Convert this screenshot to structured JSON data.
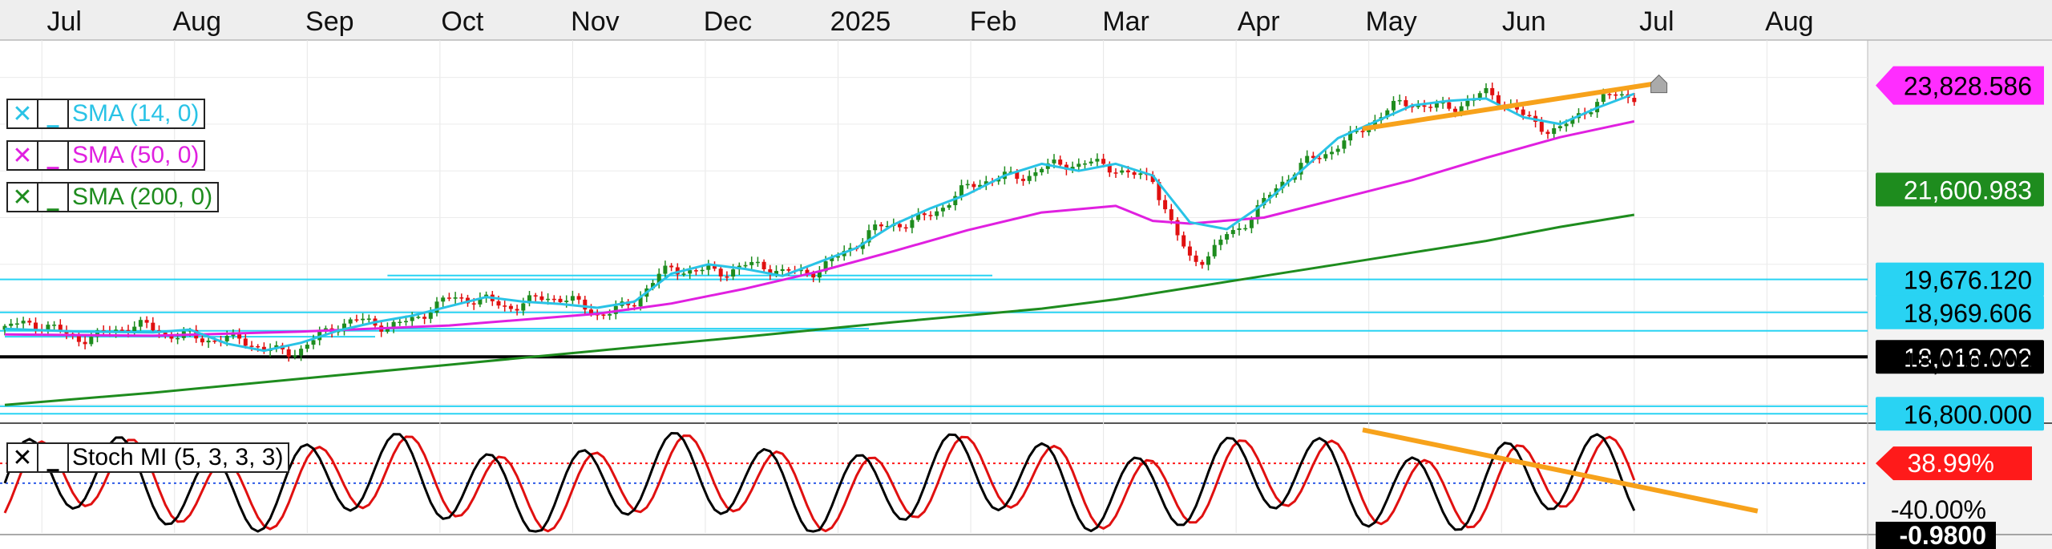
{
  "chart_data": [
    {
      "type": "candlestick",
      "months": [
        "Jul",
        "Aug",
        "Sep",
        "Oct",
        "Nov",
        "Dec",
        "2025",
        "Feb",
        "Mar",
        "Apr",
        "May",
        "Jun",
        "Jul",
        "Aug"
      ],
      "ylim": [
        16650,
        24800
      ],
      "indicators": [
        {
          "label": "SMA (14, 0)",
          "color": "#29c3e6"
        },
        {
          "label": "SMA (50, 0)",
          "color": "#e020e0"
        },
        {
          "label": "SMA (200, 0)",
          "color": "#1e8c1e"
        }
      ],
      "price_labels": [
        {
          "text": "23,828.586",
          "value": 23828.586,
          "bg": "#ff2dff",
          "fg": "#000000"
        },
        {
          "text": "21,600.983",
          "value": 21600.983,
          "bg": "#1e8c1e",
          "fg": "#ffffff"
        },
        {
          "text": "19,676.120",
          "value": 19676.12,
          "bg": "#29d3f3",
          "fg": "#000000"
        },
        {
          "text": "18,969.606",
          "value": 18969.606,
          "bg": "#29d3f3",
          "fg": "#000000"
        },
        {
          "text": "18,018.002",
          "value": 18018.002,
          "bg": "#000000",
          "fg": "#ffffff"
        },
        {
          "text": "18,000.000",
          "value": 17920,
          "bg": "none",
          "fg": "#000000"
        },
        {
          "text": "16,800.000",
          "value": 16800,
          "bg": "#29d3f3",
          "fg": "#000000"
        }
      ],
      "horizontal_lines": [
        19676.12,
        18969.606,
        18575,
        18018.002,
        16960,
        16800
      ],
      "hline_colors": {
        "cyan": "#29d3f3",
        "black": "#000000",
        "trend": "#f7a21b"
      },
      "candle_colors": {
        "up": "#1e8c1e",
        "down": "#e01010"
      },
      "series": {
        "sma14": [
          [
            0,
            18620
          ],
          [
            12,
            18560
          ],
          [
            24,
            18540
          ],
          [
            30,
            18600
          ],
          [
            36,
            18300
          ],
          [
            42,
            18150
          ],
          [
            48,
            18320
          ],
          [
            54,
            18580
          ],
          [
            60,
            18760
          ],
          [
            66,
            18900
          ],
          [
            72,
            19100
          ],
          [
            78,
            19300
          ],
          [
            84,
            19200
          ],
          [
            90,
            19150
          ],
          [
            96,
            19070
          ],
          [
            102,
            19200
          ],
          [
            108,
            19800
          ],
          [
            114,
            20000
          ],
          [
            120,
            19900
          ],
          [
            126,
            19750
          ],
          [
            132,
            20050
          ],
          [
            138,
            20350
          ],
          [
            144,
            20850
          ],
          [
            150,
            21200
          ],
          [
            156,
            21500
          ],
          [
            162,
            21900
          ],
          [
            168,
            22150
          ],
          [
            174,
            22000
          ],
          [
            180,
            22150
          ],
          [
            186,
            21900
          ],
          [
            192,
            20900
          ],
          [
            198,
            20750
          ],
          [
            204,
            21300
          ],
          [
            210,
            22000
          ],
          [
            216,
            22700
          ],
          [
            222,
            23050
          ],
          [
            228,
            23400
          ],
          [
            234,
            23500
          ],
          [
            240,
            23550
          ],
          [
            246,
            23150
          ],
          [
            252,
            23000
          ],
          [
            258,
            23350
          ],
          [
            264,
            23650
          ]
        ],
        "sma50": [
          [
            0,
            18500
          ],
          [
            24,
            18470
          ],
          [
            48,
            18560
          ],
          [
            72,
            18690
          ],
          [
            96,
            18940
          ],
          [
            108,
            19160
          ],
          [
            120,
            19480
          ],
          [
            132,
            19850
          ],
          [
            144,
            20280
          ],
          [
            156,
            20730
          ],
          [
            168,
            21110
          ],
          [
            180,
            21250
          ],
          [
            186,
            20930
          ],
          [
            192,
            20870
          ],
          [
            204,
            21000
          ],
          [
            216,
            21400
          ],
          [
            228,
            21800
          ],
          [
            240,
            22280
          ],
          [
            252,
            22720
          ],
          [
            264,
            23060
          ]
        ],
        "sma200": [
          [
            0,
            16990
          ],
          [
            24,
            17250
          ],
          [
            48,
            17550
          ],
          [
            72,
            17850
          ],
          [
            96,
            18150
          ],
          [
            120,
            18450
          ],
          [
            144,
            18760
          ],
          [
            168,
            19050
          ],
          [
            180,
            19250
          ],
          [
            192,
            19500
          ],
          [
            204,
            19750
          ],
          [
            216,
            20000
          ],
          [
            228,
            20250
          ],
          [
            240,
            20500
          ],
          [
            252,
            20800
          ],
          [
            264,
            21060
          ]
        ],
        "trend_upper": [
          [
            220,
            22900
          ],
          [
            268,
            23880
          ]
        ]
      },
      "stoch": {
        "ylim": [
          -0.98,
          1.15
        ],
        "lines": [
          0.3899,
          0.0
        ],
        "labels": [
          {
            "text": "38.99%",
            "value": 0.3899,
            "bg": "#ff1a1a",
            "fg": "#ffffff"
          },
          {
            "text": "-40.00%",
            "value": -0.4,
            "bg": "none",
            "fg": "#000000"
          },
          {
            "text": "-0.9800",
            "value": -0.98,
            "bg": "#000000",
            "fg": "#ffffff"
          }
        ],
        "indicator": {
          "label": "Stoch MI (5, 3, 3, 3)"
        },
        "trend": [
          [
            220,
            1.05
          ],
          [
            284,
            -0.55
          ]
        ]
      }
    }
  ]
}
